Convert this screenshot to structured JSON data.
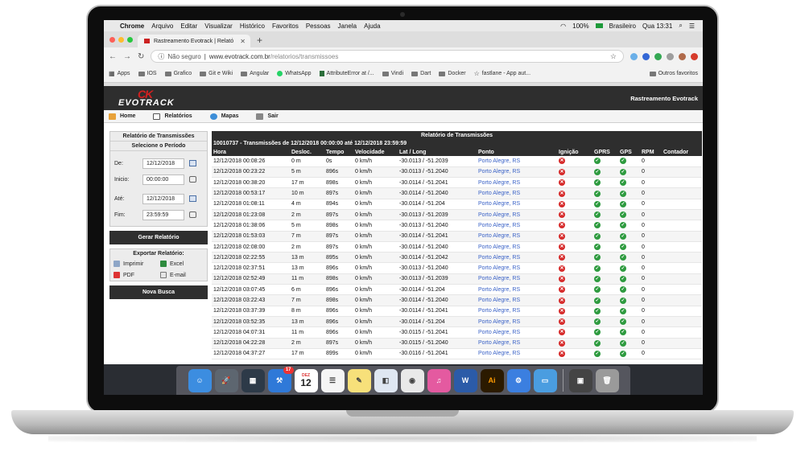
{
  "menubar": {
    "items": [
      "Chrome",
      "Arquivo",
      "Editar",
      "Visualizar",
      "Histórico",
      "Favoritos",
      "Pessoas",
      "Janela",
      "Ajuda"
    ],
    "battery": "100%",
    "input_source": "Brasileiro",
    "clock": "Qua 13:31"
  },
  "browser": {
    "tab_title": "Rastreamento Evotrack | Relató",
    "security": "Não seguro",
    "url_host": "www.evotrack.com.br",
    "url_path": "/relatorios/transmissoes",
    "bookmarks": [
      "Apps",
      "IOS",
      "Grafico",
      "Git e Wiki",
      "Angular",
      "WhatsApp",
      "AttributeError at /...",
      "Vindi",
      "Dart",
      "Docker",
      "fastlane - App aut..."
    ],
    "other_bookmarks": "Outros favoritos"
  },
  "site": {
    "logo_mark": "CK",
    "logo_text": "EVOTRACK",
    "brand": "Rastreamento Evotrack",
    "nav": [
      "Home",
      "Relatórios",
      "Mapas",
      "Sair"
    ]
  },
  "sidebar": {
    "report_title": "Relatório de Transmissões",
    "period_title": "Selecione o Período",
    "de_label": "De:",
    "de_value": "12/12/2018",
    "inicio_label": "Inicio:",
    "inicio_value": "00:00:00",
    "ate_label": "Até:",
    "ate_value": "12/12/2018",
    "fim_label": "Fim:",
    "fim_value": "23:59:59",
    "generate_button": "Gerar Relatório",
    "export_title": "Exportar Relatório:",
    "export_print": "Imprimir",
    "export_excel": "Excel",
    "export_pdf": "PDF",
    "export_email": "E-mail",
    "new_search_button": "Nova Busca"
  },
  "report": {
    "title": "Relatório de Transmissões",
    "subtitle": "10010737 - Transmissões de 12/12/2018 00:00:00 até 12/12/2018 23:59:59",
    "columns": [
      "Hora",
      "Desloc.",
      "Tempo",
      "Velocidade",
      "Lat / Long",
      "Ponto",
      "Ignição",
      "GPRS",
      "GPS",
      "RPM",
      "Contador"
    ],
    "rows": [
      {
        "hora": "12/12/2018 00:08:26",
        "desloc": "0 m",
        "tempo": "0s",
        "vel": "0 km/h",
        "latlong": "-30.0113 / -51.2039",
        "ponto": "Porto Alegre, RS",
        "rpm": "0"
      },
      {
        "hora": "12/12/2018 00:23:22",
        "desloc": "5 m",
        "tempo": "896s",
        "vel": "0 km/h",
        "latlong": "-30.0113 / -51.2040",
        "ponto": "Porto Alegre, RS",
        "rpm": "0"
      },
      {
        "hora": "12/12/2018 00:38:20",
        "desloc": "17 m",
        "tempo": "898s",
        "vel": "0 km/h",
        "latlong": "-30.0114 / -51.2041",
        "ponto": "Porto Alegre, RS",
        "rpm": "0"
      },
      {
        "hora": "12/12/2018 00:53:17",
        "desloc": "10 m",
        "tempo": "897s",
        "vel": "0 km/h",
        "latlong": "-30.0114 / -51.2040",
        "ponto": "Porto Alegre, RS",
        "rpm": "0"
      },
      {
        "hora": "12/12/2018 01:08:11",
        "desloc": "4 m",
        "tempo": "894s",
        "vel": "0 km/h",
        "latlong": "-30.0114 / -51.204",
        "ponto": "Porto Alegre, RS",
        "rpm": "0"
      },
      {
        "hora": "12/12/2018 01:23:08",
        "desloc": "2 m",
        "tempo": "897s",
        "vel": "0 km/h",
        "latlong": "-30.0113 / -51.2039",
        "ponto": "Porto Alegre, RS",
        "rpm": "0"
      },
      {
        "hora": "12/12/2018 01:38:06",
        "desloc": "5 m",
        "tempo": "898s",
        "vel": "0 km/h",
        "latlong": "-30.0113 / -51.2040",
        "ponto": "Porto Alegre, RS",
        "rpm": "0"
      },
      {
        "hora": "12/12/2018 01:53:03",
        "desloc": "7 m",
        "tempo": "897s",
        "vel": "0 km/h",
        "latlong": "-30.0114 / -51.2041",
        "ponto": "Porto Alegre, RS",
        "rpm": "0"
      },
      {
        "hora": "12/12/2018 02:08:00",
        "desloc": "2 m",
        "tempo": "897s",
        "vel": "0 km/h",
        "latlong": "-30.0114 / -51.2040",
        "ponto": "Porto Alegre, RS",
        "rpm": "0"
      },
      {
        "hora": "12/12/2018 02:22:55",
        "desloc": "13 m",
        "tempo": "895s",
        "vel": "0 km/h",
        "latlong": "-30.0114 / -51.2042",
        "ponto": "Porto Alegre, RS",
        "rpm": "0"
      },
      {
        "hora": "12/12/2018 02:37:51",
        "desloc": "13 m",
        "tempo": "896s",
        "vel": "0 km/h",
        "latlong": "-30.0113 / -51.2040",
        "ponto": "Porto Alegre, RS",
        "rpm": "0"
      },
      {
        "hora": "12/12/2018 02:52:49",
        "desloc": "11 m",
        "tempo": "898s",
        "vel": "0 km/h",
        "latlong": "-30.0113 / -51.2039",
        "ponto": "Porto Alegre, RS",
        "rpm": "0"
      },
      {
        "hora": "12/12/2018 03:07:45",
        "desloc": "6 m",
        "tempo": "896s",
        "vel": "0 km/h",
        "latlong": "-30.0114 / -51.204",
        "ponto": "Porto Alegre, RS",
        "rpm": "0"
      },
      {
        "hora": "12/12/2018 03:22:43",
        "desloc": "7 m",
        "tempo": "898s",
        "vel": "0 km/h",
        "latlong": "-30.0114 / -51.2040",
        "ponto": "Porto Alegre, RS",
        "rpm": "0"
      },
      {
        "hora": "12/12/2018 03:37:39",
        "desloc": "8 m",
        "tempo": "896s",
        "vel": "0 km/h",
        "latlong": "-30.0114 / -51.2041",
        "ponto": "Porto Alegre, RS",
        "rpm": "0"
      },
      {
        "hora": "12/12/2018 03:52:35",
        "desloc": "13 m",
        "tempo": "896s",
        "vel": "0 km/h",
        "latlong": "-30.0114 / -51.204",
        "ponto": "Porto Alegre, RS",
        "rpm": "0"
      },
      {
        "hora": "12/12/2018 04:07:31",
        "desloc": "11 m",
        "tempo": "896s",
        "vel": "0 km/h",
        "latlong": "-30.0115 / -51.2041",
        "ponto": "Porto Alegre, RS",
        "rpm": "0"
      },
      {
        "hora": "12/12/2018 04:22:28",
        "desloc": "2 m",
        "tempo": "897s",
        "vel": "0 km/h",
        "latlong": "-30.0115 / -51.2040",
        "ponto": "Porto Alegre, RS",
        "rpm": "0"
      },
      {
        "hora": "12/12/2018 04:37:27",
        "desloc": "17 m",
        "tempo": "899s",
        "vel": "0 km/h",
        "latlong": "-30.0116 / -51.2041",
        "ponto": "Porto Alegre, RS",
        "rpm": "0"
      }
    ]
  },
  "dock": {
    "calendar_month": "DEZ",
    "calendar_day": "12",
    "badge": "17",
    "apps": [
      "Finder",
      "Launchpad",
      "Mission Control",
      "Xcode",
      "Calendar",
      "Reminders",
      "Notes",
      "Preview",
      "Chrome",
      "iTunes",
      "Word",
      "Illustrator",
      "Instruments",
      "Simulator",
      "Screenshot",
      "Trash"
    ],
    "colors": [
      "#3c8de0",
      "#5d6670",
      "#2d3a48",
      "#2f79d8",
      "#ffffff",
      "#f5f5f5",
      "#f7e07a",
      "#dfe7f2",
      "#e9e9e9",
      "#e45aa0",
      "#2b5ba8",
      "#2b1a00",
      "#3b7fe0",
      "#4a9de0",
      "#444444",
      "#9a9a9a"
    ],
    "glyphs": [
      "☺",
      "🚀",
      "▦",
      "⚒",
      "",
      "☰",
      "✎",
      "◧",
      "◉",
      "♫",
      "W",
      "Ai",
      "⚙",
      "▭",
      "▣",
      "🗑"
    ]
  }
}
